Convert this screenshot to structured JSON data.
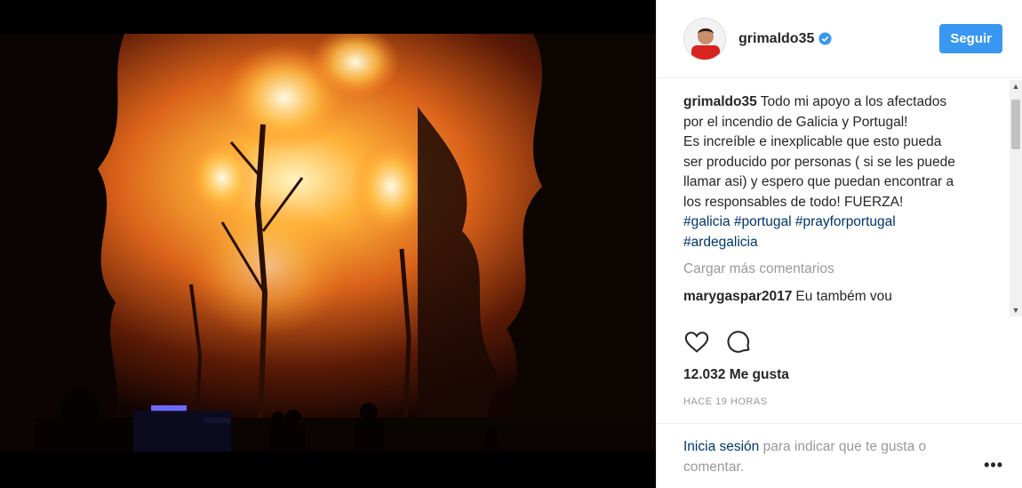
{
  "post": {
    "username": "grimaldo35",
    "follow_label": "Seguir",
    "caption_lines": [
      "Todo mi apoyo a los afectados",
      "por el incendio de Galicia y Portugal!",
      "Es increíble e inexplicable que esto pueda",
      "ser producido por personas ( si se les puede",
      "llamar asi) y espero que puedan encontrar a",
      "los responsables de todo! FUERZA!"
    ],
    "hashtags_line1": [
      "#galicia",
      "#portugal",
      "#prayforportugal"
    ],
    "hashtags_line2": [
      "#ardegalicia"
    ],
    "load_more": "Cargar más comentarios",
    "comment": {
      "username": "marygaspar2017",
      "text": "Eu também vou"
    },
    "likes": "12.032 Me gusta",
    "time": "HACE 19 HORAS",
    "login": {
      "link": "Inicia sesión",
      "rest": " para indicar que te gusta o comentar."
    },
    "more_options": "•••"
  },
  "colors": {
    "accent": "#3897f0",
    "link": "#003569",
    "muted": "#999999"
  },
  "icons": {
    "like": "heart-icon",
    "comment": "comment-bubble-icon",
    "verified": "verified-badge-icon",
    "more": "more-options-icon"
  }
}
